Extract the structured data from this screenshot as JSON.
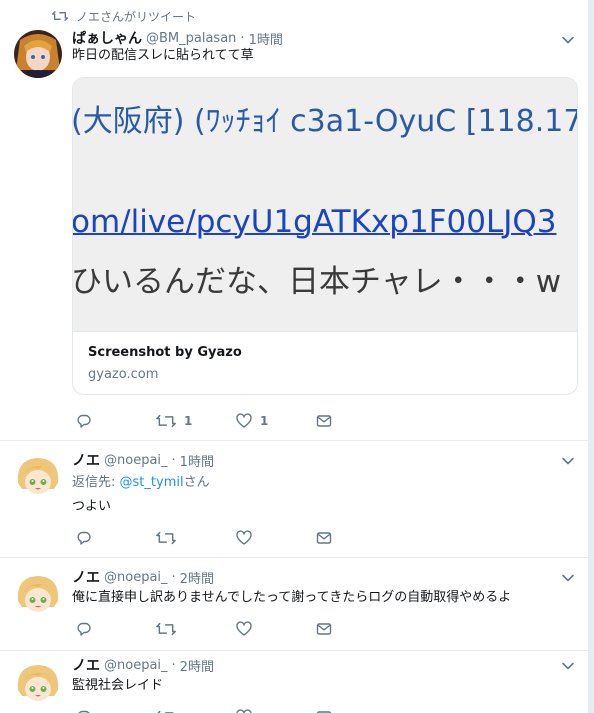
{
  "colors": {
    "accent": "#1b95e0",
    "muted": "#657786",
    "border": "#e6ecf0"
  },
  "tweets": [
    {
      "retweet_context": "ノエさんがリツイート",
      "name": "ぱぁしゃん",
      "handle": "@BM_palasan",
      "time": "1時間",
      "text": "昨日の配信スレに貼られてて草",
      "card": {
        "image_line1": "(大阪府) (ﾜｯﾁｮｲ c3a1-OyuC [118.17",
        "image_line2": "om/live/pcyU1gATKxp1F00LJQ3",
        "image_line3": "ひいるんだな、日本チャレ・・・w",
        "title": "Screenshot by Gyazo",
        "domain": "gyazo.com"
      },
      "retweets": "1",
      "likes": "1"
    },
    {
      "name": "ノエ",
      "handle": "@noepai_",
      "time": "1時間",
      "reply_to_label": "返信先:",
      "reply_to_mention": "@st_tymil",
      "reply_to_suffix": "さん",
      "text": "つよい"
    },
    {
      "name": "ノエ",
      "handle": "@noepai_",
      "time": "2時間",
      "text": "俺に直接申し訳ありませんでしたって謝ってきたらログの自動取得やめるよ"
    },
    {
      "name": "ノエ",
      "handle": "@noepai_",
      "time": "2時間",
      "text": "監視社会レイド"
    }
  ]
}
